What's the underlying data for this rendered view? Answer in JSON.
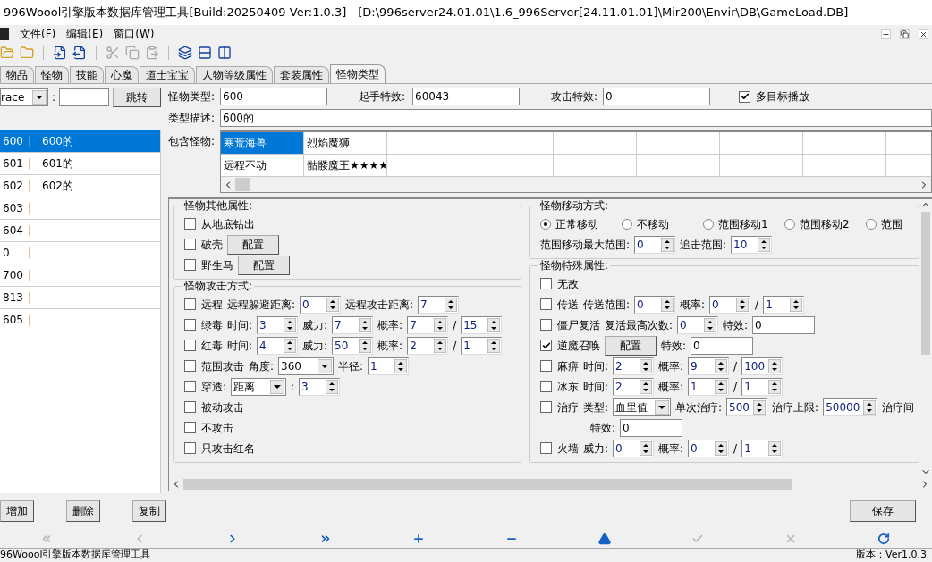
{
  "window": {
    "title": "996Woool引擎版本数据库管理工具[Build:20250409 Ver:1.0.3] - [D:\\996server24.01.01\\1.6_996Server[24.11.01.01]\\Mir200\\Envir\\DB\\GameLoad.DB]"
  },
  "menu": [
    {
      "label": "文件(F)"
    },
    {
      "label": "编辑(E)"
    },
    {
      "label": "窗口(W)"
    }
  ],
  "toolbar": [
    {
      "kind": "open",
      "disabled": false
    },
    {
      "kind": "folder",
      "disabled": false
    },
    {
      "kind": "import",
      "disabled": false
    },
    {
      "kind": "export",
      "disabled": false
    },
    {
      "kind": "cut",
      "disabled": true
    },
    {
      "kind": "copy",
      "disabled": true
    },
    {
      "kind": "paste",
      "disabled": true
    },
    {
      "kind": "cascade",
      "disabled": false
    },
    {
      "kind": "rows",
      "disabled": false
    },
    {
      "kind": "columns",
      "disabled": false
    }
  ],
  "tabs": [
    {
      "label": "物品",
      "selected": false
    },
    {
      "label": "怪物",
      "selected": false
    },
    {
      "label": "技能",
      "selected": false
    },
    {
      "label": "心魔",
      "selected": false
    },
    {
      "label": "道士宝宝",
      "selected": false
    },
    {
      "label": "人物等级属性",
      "selected": false
    },
    {
      "label": "套装属性",
      "selected": false
    },
    {
      "label": "怪物类型",
      "selected": true
    }
  ],
  "search": {
    "field": "race",
    "separator": ":",
    "button": "跳转"
  },
  "list": [
    {
      "id": "600",
      "sep": "|",
      "name": "600的",
      "selected": true
    },
    {
      "id": "601",
      "sep": "|",
      "name": "601的",
      "selected": false
    },
    {
      "id": "602",
      "sep": "|",
      "name": "602的",
      "selected": false
    },
    {
      "id": "603",
      "sep": "|",
      "selected": false
    },
    {
      "id": "604",
      "sep": "|",
      "selected": false
    },
    {
      "id": "0",
      "sep": "|",
      "selected": false
    },
    {
      "id": "700",
      "sep": "|",
      "selected": false
    },
    {
      "id": "813",
      "sep": "|",
      "selected": false
    },
    {
      "id": "605",
      "sep": "|",
      "selected": false
    }
  ],
  "form": {
    "type_label": "怪物类型:",
    "type_value": "600",
    "start_label": "起手特效:",
    "start_value": "60043",
    "attack_label": "攻击特效:",
    "attack_value": "0",
    "multi": {
      "label": "多目标播放",
      "checked": true
    },
    "desc_label": "类型描述:",
    "desc_value": "600的",
    "contains_label": "包含怪物:",
    "grid": [
      [
        {
          "text": "寒荒海兽",
          "selected": true
        },
        {
          "text": "烈焰魔狮",
          "selected": false
        }
      ],
      [
        {
          "text": "远程不动",
          "selected": false
        },
        {
          "text": "骷髅魔王★★★★",
          "selected": false
        }
      ]
    ]
  },
  "left_groups": [
    {
      "title": "怪物其他属性:",
      "rows": [
        {
          "parts": [
            {
              "kind": "check",
              "label": "从地底钻出",
              "checked": false
            }
          ]
        },
        {
          "parts": [
            {
              "kind": "check",
              "label": "破壳",
              "checked": false
            },
            {
              "kind": "button",
              "label": "配置"
            }
          ]
        },
        {
          "parts": [
            {
              "kind": "check",
              "label": "野生马",
              "checked": false
            },
            {
              "kind": "button",
              "label": "配置"
            }
          ]
        }
      ]
    },
    {
      "title": "怪物攻击方式:",
      "rows": [
        {
          "parts": [
            {
              "kind": "check",
              "label": "远程",
              "checked": false
            },
            {
              "kind": "text",
              "text": "远程躲避距离:"
            },
            {
              "kind": "spin",
              "value": "0"
            },
            {
              "kind": "text",
              "text": "远程攻击距离:"
            },
            {
              "kind": "spin",
              "value": "7"
            }
          ]
        },
        {
          "parts": [
            {
              "kind": "check",
              "label": "绿毒",
              "checked": false
            },
            {
              "kind": "text",
              "text": "时间:"
            },
            {
              "kind": "spin",
              "value": "3"
            },
            {
              "kind": "text",
              "text": "威力:"
            },
            {
              "kind": "spin",
              "value": "7"
            },
            {
              "kind": "text",
              "text": "概率:"
            },
            {
              "kind": "spin",
              "value": "7"
            },
            {
              "kind": "text",
              "text": "/"
            },
            {
              "kind": "spin",
              "value": "15"
            }
          ]
        },
        {
          "parts": [
            {
              "kind": "check",
              "label": "红毒",
              "checked": false
            },
            {
              "kind": "text",
              "text": "时间:"
            },
            {
              "kind": "spin",
              "value": "4"
            },
            {
              "kind": "text",
              "text": "威力:"
            },
            {
              "kind": "spin",
              "value": "50"
            },
            {
              "kind": "text",
              "text": "概率:"
            },
            {
              "kind": "spin",
              "value": "2"
            },
            {
              "kind": "text",
              "text": "/"
            },
            {
              "kind": "spin",
              "value": "1"
            }
          ]
        },
        {
          "parts": [
            {
              "kind": "check",
              "label": "范围攻击",
              "checked": false
            },
            {
              "kind": "text",
              "text": "角度:"
            },
            {
              "kind": "combo",
              "value": "360"
            },
            {
              "kind": "text",
              "text": "半径:"
            },
            {
              "kind": "spin",
              "value": "1"
            }
          ]
        },
        {
          "parts": [
            {
              "kind": "check",
              "label": "穿透:",
              "checked": false
            },
            {
              "kind": "combo",
              "value": "距离"
            },
            {
              "kind": "text",
              "text": ":"
            },
            {
              "kind": "spin",
              "value": "3"
            }
          ]
        },
        {
          "parts": [
            {
              "kind": "check",
              "label": "被动攻击",
              "checked": false
            }
          ]
        },
        {
          "parts": [
            {
              "kind": "check",
              "label": "不攻击",
              "checked": false
            }
          ]
        },
        {
          "parts": [
            {
              "kind": "check",
              "label": "只攻击红名",
              "checked": false
            }
          ]
        }
      ]
    }
  ],
  "right_groups": [
    {
      "title": "怪物移动方式:",
      "rows": [
        {
          "parts": [
            {
              "kind": "radio",
              "label": "正常移动",
              "selected": true
            },
            {
              "kind": "radio",
              "label": "不移动",
              "selected": false
            },
            {
              "kind": "radio",
              "label": "范围移动1",
              "selected": false
            },
            {
              "kind": "radio",
              "label": "范围移动2",
              "selected": false
            },
            {
              "kind": "radio",
              "label": "范围",
              "selected": false
            }
          ]
        },
        {
          "parts": [
            {
              "kind": "text",
              "text": "范围移动最大范围:"
            },
            {
              "kind": "spin",
              "value": "0"
            },
            {
              "kind": "text",
              "text": "追击范围:"
            },
            {
              "kind": "spin",
              "value": "10"
            }
          ]
        }
      ]
    },
    {
      "title": "怪物特殊属性:",
      "rows": [
        {
          "parts": [
            {
              "kind": "check",
              "label": "无敌",
              "checked": false
            }
          ]
        },
        {
          "parts": [
            {
              "kind": "check",
              "label": "传送",
              "checked": false
            },
            {
              "kind": "text",
              "text": "传送范围:"
            },
            {
              "kind": "spin",
              "value": "0"
            },
            {
              "kind": "text",
              "text": "概率:"
            },
            {
              "kind": "spin",
              "value": "0"
            },
            {
              "kind": "text",
              "text": "/"
            },
            {
              "kind": "spin",
              "value": "1"
            }
          ]
        },
        {
          "parts": [
            {
              "kind": "check",
              "label": "僵尸复活",
              "checked": false
            },
            {
              "kind": "text",
              "text": "复活最高次数:"
            },
            {
              "kind": "spin",
              "value": "0"
            },
            {
              "kind": "text",
              "text": "特效:"
            },
            {
              "kind": "field",
              "value": "0"
            }
          ]
        },
        {
          "parts": [
            {
              "kind": "check",
              "label": "逆魔召唤",
              "checked": true
            },
            {
              "kind": "button",
              "label": "配置"
            },
            {
              "kind": "text",
              "text": "特效:"
            },
            {
              "kind": "field",
              "value": "0"
            }
          ]
        },
        {
          "parts": [
            {
              "kind": "check",
              "label": "麻痹",
              "checked": false
            },
            {
              "kind": "text",
              "text": "时间:"
            },
            {
              "kind": "spin",
              "value": "2"
            },
            {
              "kind": "text",
              "text": "概率:"
            },
            {
              "kind": "spin",
              "value": "9"
            },
            {
              "kind": "text",
              "text": "/"
            },
            {
              "kind": "spin",
              "value": "100"
            }
          ]
        },
        {
          "parts": [
            {
              "kind": "check",
              "label": "冰东",
              "checked": false
            },
            {
              "kind": "text",
              "text": "时间:"
            },
            {
              "kind": "spin",
              "value": "2"
            },
            {
              "kind": "text",
              "text": "概率:"
            },
            {
              "kind": "spin",
              "value": "1"
            },
            {
              "kind": "text",
              "text": "/"
            },
            {
              "kind": "spin",
              "value": "1"
            }
          ]
        },
        {
          "parts": [
            {
              "kind": "check",
              "label": "治疗",
              "checked": false
            },
            {
              "kind": "text",
              "text": "类型:"
            },
            {
              "kind": "combo",
              "value": "血里值"
            },
            {
              "kind": "text",
              "text": "单次治疗:"
            },
            {
              "kind": "spin",
              "value": "500"
            },
            {
              "kind": "text",
              "text": "治疗上限:"
            },
            {
              "kind": "spin",
              "value": "50000"
            },
            {
              "kind": "text",
              "text": "治疗间"
            }
          ],
          "sub": [
            {
              "kind": "text",
              "text": "特效:"
            },
            {
              "kind": "field",
              "value": "0"
            }
          ]
        },
        {
          "parts": [
            {
              "kind": "check",
              "label": "火墙",
              "checked": false
            },
            {
              "kind": "text",
              "text": "威力:"
            },
            {
              "kind": "spin",
              "value": "0"
            },
            {
              "kind": "text",
              "text": "概率:"
            },
            {
              "kind": "spin",
              "value": "0"
            },
            {
              "kind": "text",
              "text": "/"
            },
            {
              "kind": "spin",
              "value": "1"
            }
          ]
        }
      ]
    }
  ],
  "buttons_left": [
    "增加",
    "删除",
    "复制"
  ],
  "button_right": "保存",
  "nav": [
    {
      "kind": "first",
      "disabled": true
    },
    {
      "kind": "prev",
      "disabled": true
    },
    {
      "kind": "next",
      "disabled": false
    },
    {
      "kind": "last",
      "disabled": false
    },
    {
      "kind": "add",
      "disabled": false
    },
    {
      "kind": "remove",
      "disabled": false
    },
    {
      "kind": "up",
      "disabled": false
    },
    {
      "kind": "confirm",
      "disabled": true
    },
    {
      "kind": "cancel",
      "disabled": true
    },
    {
      "kind": "refresh",
      "disabled": false
    }
  ],
  "status": {
    "left": "96Woool引擎版本数据库管理工具",
    "right": "版本：Ver1.0.3"
  }
}
